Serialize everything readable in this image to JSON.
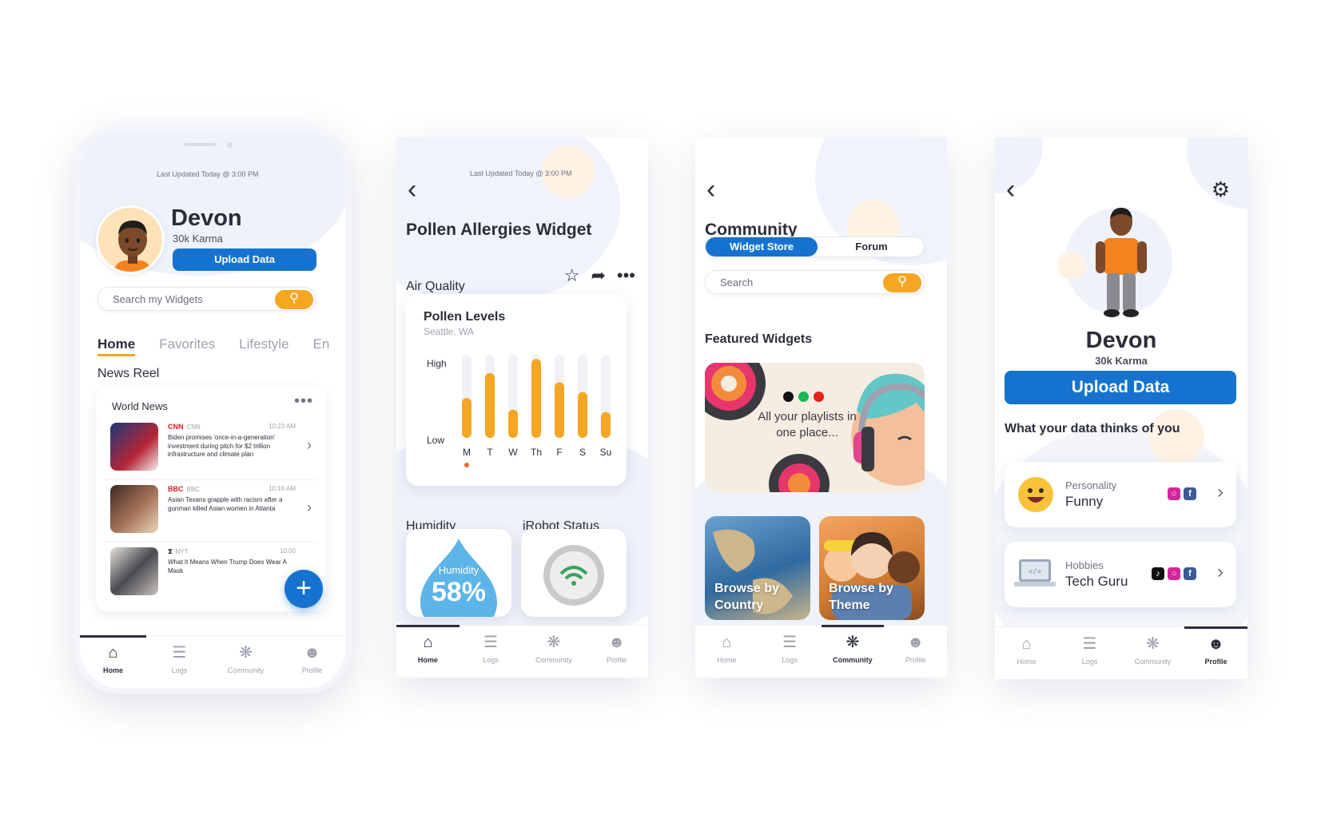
{
  "colors": {
    "accent": "#1573cf",
    "orange": "#f5a623",
    "text": "#2b2e3a",
    "muted": "#9ea1ad"
  },
  "nav": [
    "Home",
    "Logs",
    "Community",
    "Profile"
  ],
  "s1": {
    "updated": "Last Updated Today @ 3:00 PM",
    "name": "Devon",
    "karma": "30k Karma",
    "upload": "Upload Data",
    "search_placeholder": "Search my Widgets",
    "tabs": [
      "Home",
      "Favorites",
      "Lifestyle",
      "En"
    ],
    "news_reel": "News Reel",
    "world_news": "World News",
    "news": [
      {
        "logo": "CNN",
        "source": "CNN",
        "time": "10:23 AM",
        "headline": "Biden promises 'once-in-a-generation' investment during pitch for $2 trillion infrastructure and climate plan"
      },
      {
        "logo": "BBC",
        "source": "BBC",
        "time": "10:16 AM",
        "headline": "Asian Texans grapple with racism after a gunman killed Asian women in Atlanta"
      },
      {
        "logo": "𝕿",
        "source": "NYT",
        "time": "10:00",
        "headline": "What It Means When Trump Does Wear A Mask"
      }
    ]
  },
  "s2": {
    "updated": "Last Updated Today @ 3:00 PM",
    "title": "Pollen Allergies Widget",
    "air_quality": "Air Quality",
    "card_title": "Pollen Levels",
    "location": "Seattle, WA",
    "high": "High",
    "low": "Low",
    "humidity": "Humidity",
    "irobot": "iRobot Status",
    "humidity_label": "Humidity",
    "humidity_value": "58%"
  },
  "chart_data": {
    "type": "bar",
    "title": "Pollen Levels",
    "categories": [
      "M",
      "T",
      "W",
      "Th",
      "F",
      "S",
      "Su"
    ],
    "values": [
      0.48,
      0.78,
      0.34,
      0.95,
      0.67,
      0.55,
      0.31
    ],
    "ylabels": [
      "Low",
      "High"
    ],
    "ylim": [
      0,
      1
    ],
    "selected": "M"
  },
  "s3": {
    "title": "Community",
    "seg": [
      "Widget Store",
      "Forum"
    ],
    "search_placeholder": "Search",
    "featured": "Featured Widgets",
    "playlist": "All your playlists in one place...",
    "browse_country": "Browse by Country",
    "browse_theme": "Browse by Theme"
  },
  "s4": {
    "name": "Devon",
    "karma": "30k Karma",
    "upload": "Upload Data",
    "thinks": "What your data thinks of you",
    "traits": [
      {
        "key": "Personality",
        "value": "Funny"
      },
      {
        "key": "Hobbies",
        "value": "Tech Guru"
      }
    ]
  }
}
